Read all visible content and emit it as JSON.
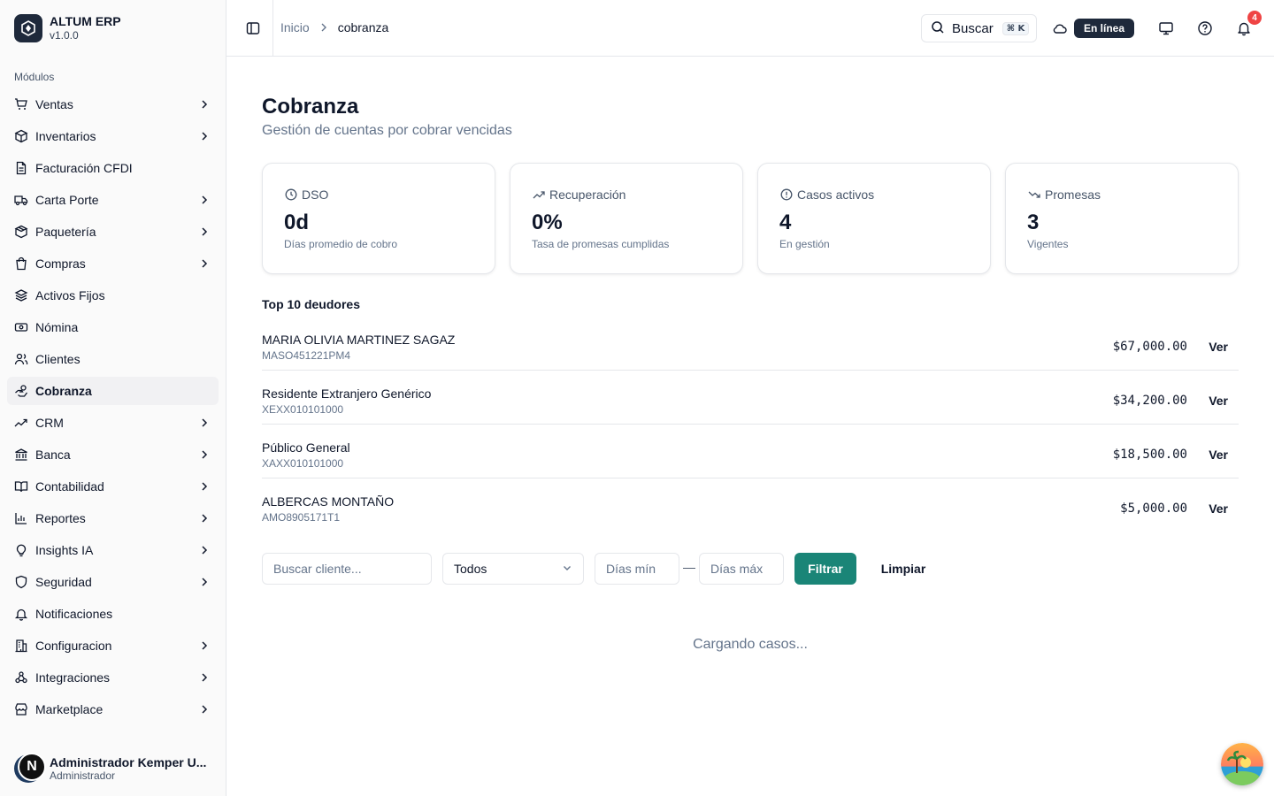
{
  "app": {
    "name": "ALTUM ERP",
    "version": "v1.0.0"
  },
  "sidebar": {
    "section_label": "Módulos",
    "items": [
      {
        "label": "Ventas",
        "icon": "cart-icon",
        "chevron": true
      },
      {
        "label": "Inventarios",
        "icon": "box-icon",
        "chevron": true
      },
      {
        "label": "Facturación CFDI",
        "icon": "document-icon",
        "chevron": false
      },
      {
        "label": "Carta Porte",
        "icon": "truck-icon",
        "chevron": true
      },
      {
        "label": "Paquetería",
        "icon": "package-icon",
        "chevron": true
      },
      {
        "label": "Compras",
        "icon": "shopping-bag-icon",
        "chevron": true
      },
      {
        "label": "Activos Fijos",
        "icon": "layers-icon",
        "chevron": false
      },
      {
        "label": "Nómina",
        "icon": "banknote-icon",
        "chevron": false
      },
      {
        "label": "Clientes",
        "icon": "users-icon",
        "chevron": false
      },
      {
        "label": "Cobranza",
        "icon": "hand-coins-icon",
        "chevron": false,
        "active": true
      },
      {
        "label": "CRM",
        "icon": "trending-up-icon",
        "chevron": true
      },
      {
        "label": "Banca",
        "icon": "bank-icon",
        "chevron": true
      },
      {
        "label": "Contabilidad",
        "icon": "book-open-icon",
        "chevron": true
      },
      {
        "label": "Reportes",
        "icon": "bar-chart-icon",
        "chevron": true
      },
      {
        "label": "Insights IA",
        "icon": "lightbulb-icon",
        "chevron": true
      },
      {
        "label": "Seguridad",
        "icon": "shield-icon",
        "chevron": true
      },
      {
        "label": "Notificaciones",
        "icon": "bell-icon",
        "chevron": false
      },
      {
        "label": "Configuracion",
        "icon": "building-icon",
        "chevron": true
      },
      {
        "label": "Integraciones",
        "icon": "webhook-icon",
        "chevron": true
      },
      {
        "label": "Marketplace",
        "icon": "store-icon",
        "chevron": true
      }
    ]
  },
  "user": {
    "initial": "N",
    "name": "Administrador Kemper U...",
    "role": "Administrador"
  },
  "header": {
    "breadcrumb_home": "Inicio",
    "breadcrumb_current": "cobranza",
    "search_label": "Buscar",
    "search_shortcut": "⌘ K",
    "status": "En línea",
    "notification_count": "4"
  },
  "page": {
    "title": "Cobranza",
    "subtitle": "Gestión de cuentas por cobrar vencidas"
  },
  "kpis": [
    {
      "label": "DSO",
      "icon": "clock-icon",
      "value": "0d",
      "sub": "Días promedio de cobro"
    },
    {
      "label": "Recuperación",
      "icon": "trending-up-icon",
      "value": "0%",
      "sub": "Tasa de promesas cumplidas"
    },
    {
      "label": "Casos activos",
      "icon": "alert-circle-icon",
      "value": "4",
      "sub": "En gestión"
    },
    {
      "label": "Promesas",
      "icon": "trending-down-icon",
      "value": "3",
      "sub": "Vigentes"
    }
  ],
  "debtors": {
    "title": "Top 10 deudores",
    "action_label": "Ver",
    "rows": [
      {
        "name": "MARIA OLIVIA MARTINEZ SAGAZ",
        "rfc": "MASO451221PM4",
        "amount": "$67,000.00"
      },
      {
        "name": "Residente Extranjero Genérico",
        "rfc": "XEXX010101000",
        "amount": "$34,200.00"
      },
      {
        "name": "Público General",
        "rfc": "XAXX010101000",
        "amount": "$18,500.00"
      },
      {
        "name": "ALBERCAS MONTAÑO",
        "rfc": "AMO8905171T1",
        "amount": "$5,000.00"
      }
    ]
  },
  "filters": {
    "search_placeholder": "Buscar cliente...",
    "status_value": "Todos",
    "days_min_placeholder": "Días mín",
    "days_max_placeholder": "Días máx",
    "separator": "—",
    "filter_button": "Filtrar",
    "clear_button": "Limpiar"
  },
  "loading_text": "Cargando casos...",
  "colors": {
    "primary": "#1a8577",
    "badge_bg": "#1e293b",
    "notification": "#ef4444"
  }
}
